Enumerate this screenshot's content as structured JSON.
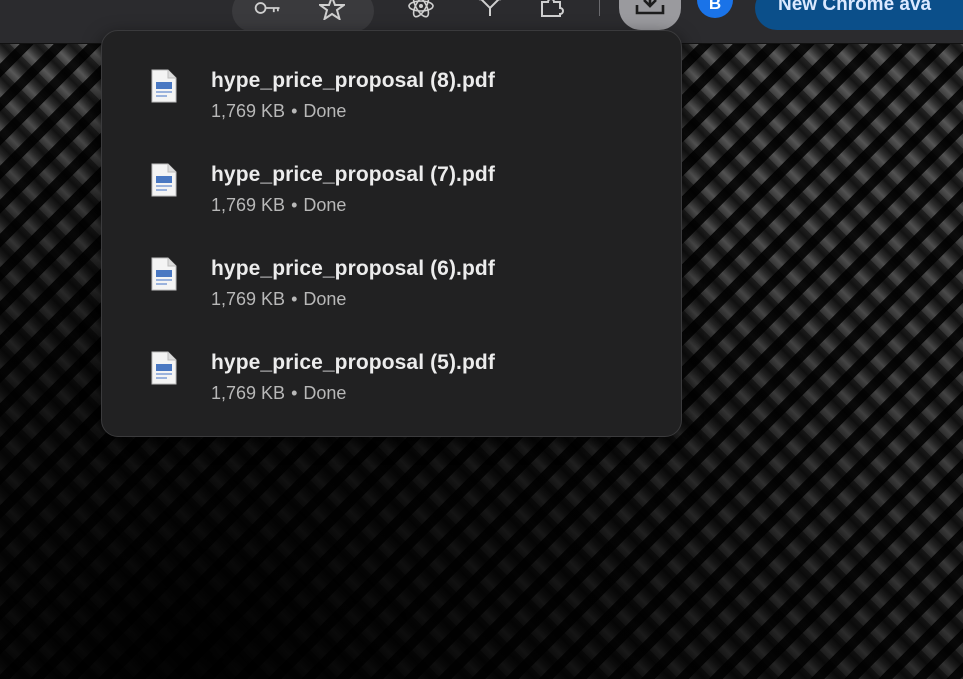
{
  "toolbar": {
    "profile_initial": "B",
    "update_chip_label": "New Chrome ava"
  },
  "downloads": [
    {
      "name": "hype_price_proposal (8).pdf",
      "size": "1,769 KB",
      "status": "Done"
    },
    {
      "name": "hype_price_proposal (7).pdf",
      "size": "1,769 KB",
      "status": "Done"
    },
    {
      "name": "hype_price_proposal (6).pdf",
      "size": "1,769 KB",
      "status": "Done"
    },
    {
      "name": "hype_price_proposal (5).pdf",
      "size": "1,769 KB",
      "status": "Done"
    }
  ],
  "separator": "•",
  "icons": {
    "password": "key-icon",
    "bookmark": "star-icon",
    "extension_1": "react-icon",
    "extension_2": "puzzle-extension-icon",
    "extension_3": "puzzle-icon",
    "downloads": "download-icon",
    "file": "pdf-file-icon"
  },
  "colors": {
    "accent": "#1a73e8",
    "panel_bg": "#212122",
    "update_chip": "#0b4f8a"
  }
}
